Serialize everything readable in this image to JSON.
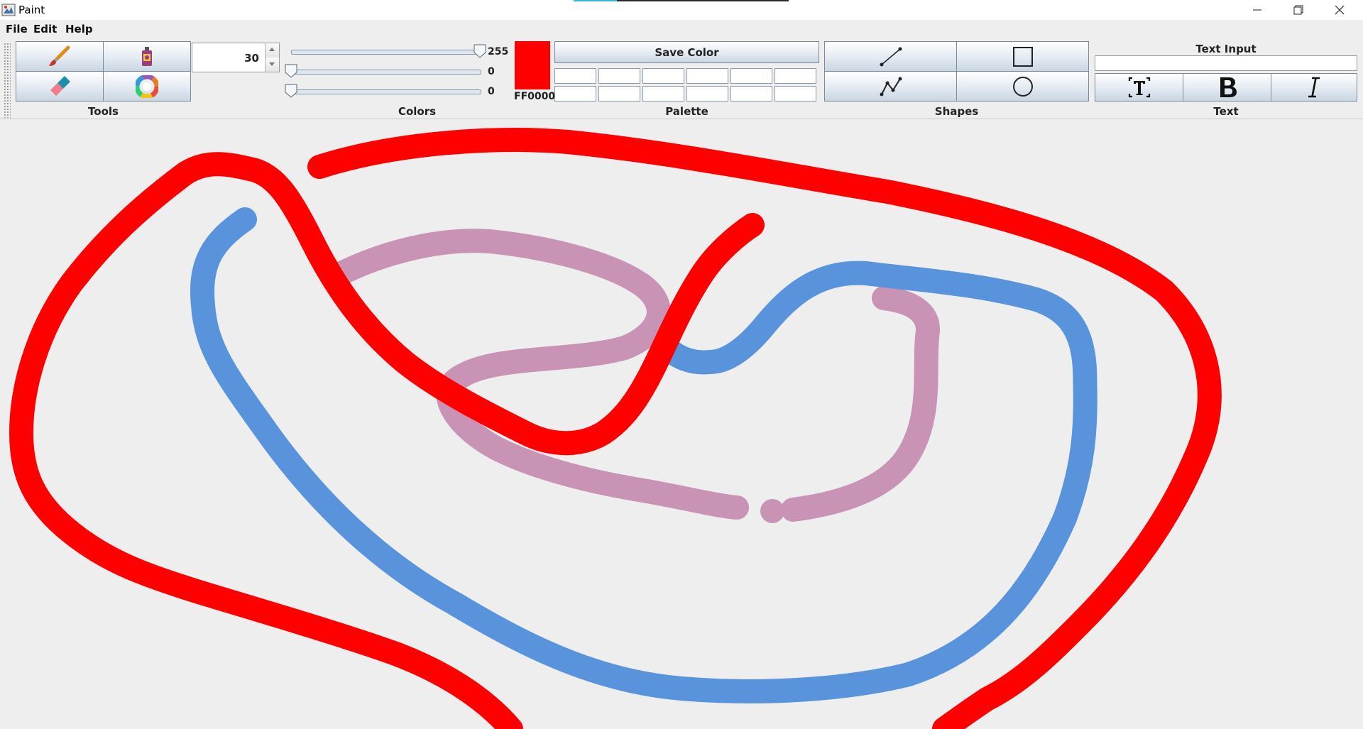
{
  "window": {
    "title": "Paint",
    "app_icon": "paint-app-icon",
    "controls": [
      "minimize-icon",
      "restore-icon",
      "close-icon"
    ]
  },
  "menu": {
    "items": [
      "File",
      "Edit",
      "Help"
    ]
  },
  "tools": {
    "label": "Tools",
    "buttons": [
      "brush-icon",
      "spray-can-icon",
      "eraser-icon",
      "color-wheel-icon"
    ],
    "brush_size": "30"
  },
  "colors": {
    "label": "Colors",
    "red": "255",
    "green": "0",
    "blue": "0",
    "red_level": 1.0,
    "green_level": 0.0,
    "blue_level": 0.0,
    "current_hex": "FF0000",
    "current_color": "#ff0000"
  },
  "palette": {
    "label": "Palette",
    "save_label": "Save Color",
    "slots": [
      "",
      "",
      "",
      "",
      "",
      "",
      "",
      "",
      "",
      "",
      "",
      ""
    ]
  },
  "shapes": {
    "label": "Shapes",
    "buttons": [
      "line-icon",
      "rectangle-icon",
      "polyline-icon",
      "circle-icon"
    ]
  },
  "text": {
    "label": "Text",
    "input_label": "Text Input",
    "input_value": "",
    "buttons": [
      "text-box-icon",
      "bold-icon",
      "italic-icon"
    ]
  },
  "drawing": {
    "stroke_colors": [
      "#ff0000",
      "#5893dc",
      "#c893b4"
    ]
  }
}
